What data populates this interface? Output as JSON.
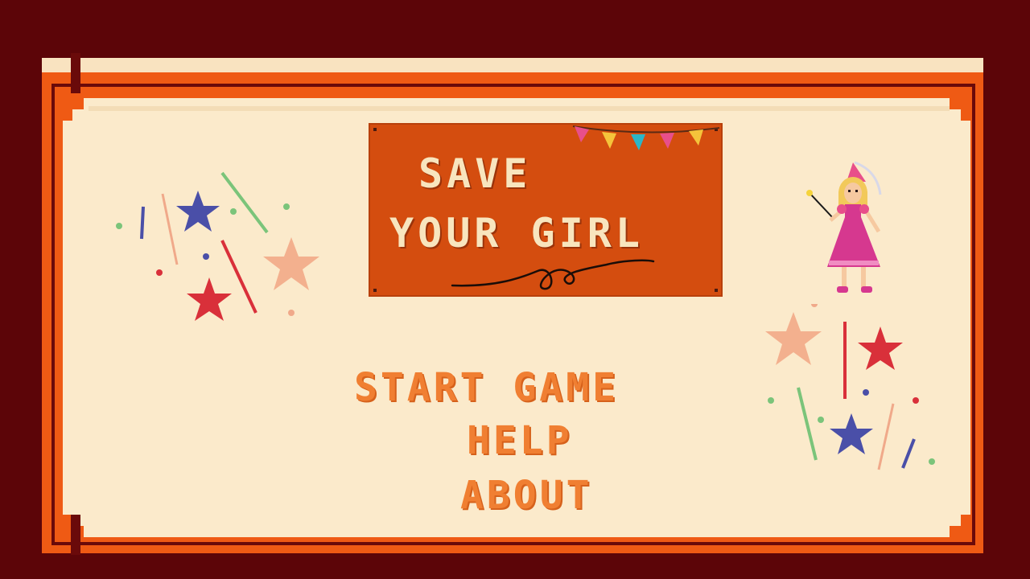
{
  "title": {
    "line1": "SAVE",
    "line2": "YOUR GIRL"
  },
  "menu": {
    "start": "START GAME",
    "help": "HELP",
    "about": "ABOUT"
  },
  "colors": {
    "background": "#5c0508",
    "frame_orange": "#ef5a14",
    "panel_cream": "#fbeacb",
    "sign_orange": "#d44d0f",
    "title_text": "#f8e5be",
    "menu_text": "#f07f32"
  },
  "icons": [
    "bunting-flags-icon",
    "star-icon",
    "confetti-icon",
    "princess-character-icon",
    "squiggle-icon"
  ]
}
